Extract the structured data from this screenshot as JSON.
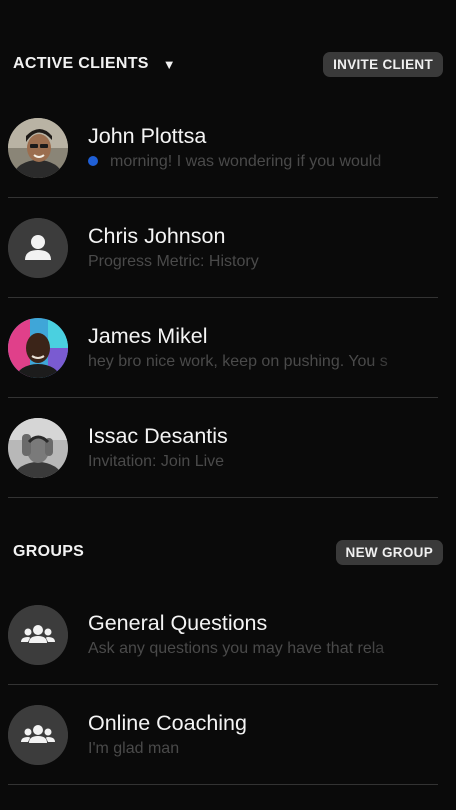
{
  "active_clients": {
    "title": "ACTIVE CLIENTS",
    "invite_label": "INVITE CLIENT",
    "clients": [
      {
        "name": "John Plottsa",
        "preview": "morning! I was wondering if you would",
        "unread": true,
        "avatar": "photo"
      },
      {
        "name": "Chris Johnson",
        "preview": "Progress Metric: History",
        "unread": false,
        "avatar": "placeholder"
      },
      {
        "name": "James Mikel",
        "preview": "hey bro nice work, keep on pushing. You s",
        "unread": false,
        "avatar": "photo"
      },
      {
        "name": "Issac Desantis",
        "preview": "Invitation: Join Live",
        "unread": false,
        "avatar": "photo"
      }
    ]
  },
  "groups": {
    "title": "GROUPS",
    "new_group_label": "NEW GROUP",
    "items": [
      {
        "name": "General Questions",
        "preview": "Ask any questions you may have that rela"
      },
      {
        "name": "Online Coaching",
        "preview": "I'm glad man"
      }
    ]
  },
  "colors": {
    "background": "#0a0a0a",
    "pill": "#3a3a3a",
    "unread_dot": "#1f5fd6",
    "divider": "#333333"
  }
}
